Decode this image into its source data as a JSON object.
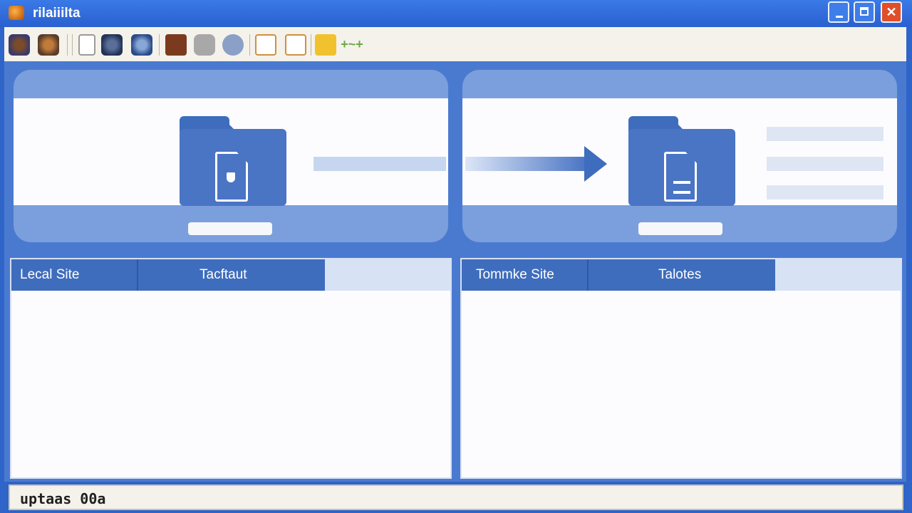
{
  "window": {
    "title": "rilaiiilta",
    "minimize_label": "_",
    "close_label": "✕"
  },
  "toolbar": {
    "icons": [
      "site-manager-icon",
      "connect-icon",
      "new-file-icon",
      "refresh-icon",
      "globe-icon",
      "stop-icon",
      "queue-icon",
      "network-icon",
      "compare-icon",
      "edit-icon",
      "folder-sync-icon",
      "add-icon"
    ],
    "add_glyph": "+~+"
  },
  "local_pane": {
    "header_label": "Lecal Site",
    "column_label": "Tacftaut"
  },
  "remote_pane": {
    "header_label": "Tommke Site",
    "column_label": "Talotes"
  },
  "status": {
    "text": "uptaas  00a"
  },
  "colors": {
    "accent": "#3f6dbd",
    "titlebar": "#2a5fd0",
    "close": "#df4f2a"
  }
}
